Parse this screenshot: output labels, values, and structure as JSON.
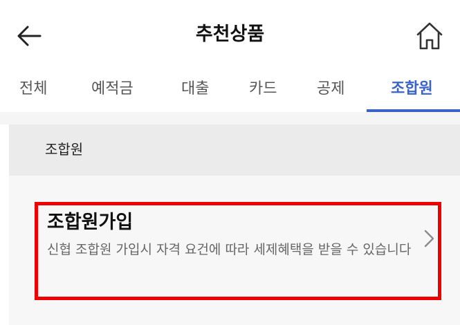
{
  "header": {
    "title": "추천상품",
    "back_icon": "arrow-left-icon",
    "home_icon": "home-icon"
  },
  "tabs": [
    {
      "label": "전체"
    },
    {
      "label": "예적금"
    },
    {
      "label": "대출"
    },
    {
      "label": "카드"
    },
    {
      "label": "공제"
    },
    {
      "label": "조합원"
    }
  ],
  "active_tab": "조합원",
  "section": {
    "title": "조합원"
  },
  "items": [
    {
      "title": "조합원가입",
      "description": "신협 조합원 가입시 자격 요건에 따라 세제혜택을 받을 수 있습니다",
      "icon": "chevron-right-icon"
    }
  ],
  "colors": {
    "accent": "#3a63c7",
    "highlight_border": "#ee0000",
    "section_bg": "#ebebeb",
    "list_bg": "#f7f7f7"
  }
}
